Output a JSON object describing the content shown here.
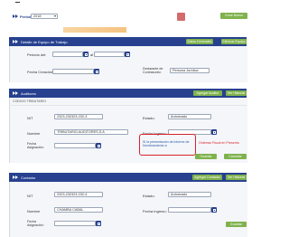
{
  "top": {
    "periodo_label": "Periodo",
    "periodo_value": "2018",
    "nuevo_label": "Crear Nuevo"
  },
  "detalle": {
    "title": "Detalle de Equipo de Trabajo",
    "btn1": "Datos Generales",
    "btn2": "Eliminar Equipo",
    "periodo_del_label": "Periodo del:",
    "al_label": "al",
    "fecha_creacion_label": "Fecha Creación:",
    "declarante_label": "Declarante de Contrasunto:",
    "declarante_value": "Persona Jurídica"
  },
  "auditores": {
    "title": "Auditores",
    "btn1": "Agregar Auditor",
    "btn2": "Ver Historial",
    "sub": "CODIGO TRIBUTARIO",
    "nit_label": "NIT",
    "nit_value": "2323-232323-232-3",
    "estado_label": "Estado:",
    "estado_value": "Autorizado",
    "nombre_label": "Nombre",
    "nombre_value": "TRIBUTARIO AUDITORES,S.A",
    "fecha_ingreso_label": "Fecha Ingreso:",
    "fecha_asign_label": "Fecha Asignación:",
    "alert_text": "Si la presentación de informe de Nombramiento a",
    "alert_text2": "Ordenan Fiscal en Presento",
    "btn_guardar": "Guardar",
    "btn_cancel": "Cancelar"
  },
  "contador": {
    "title": "Contador",
    "btn1": "Agregar Contador",
    "btn2": "Ver Historial",
    "nit_label": "NIT",
    "nit_value": "2323-232323-232-4",
    "estado_label": "Estado:",
    "estado_value": "Autorizado",
    "nombre_label": "Nombre",
    "nombre_value": "CHAMBA CABAL",
    "fecha_ingreso_label": "Fecha Ingreso:",
    "fecha_asign_label": "Fecha Asignación:",
    "btn_guardar": "Guardar"
  },
  "colors": {
    "bar": "#27418f",
    "green": "#7fb24d",
    "alert": "#d9232d"
  }
}
